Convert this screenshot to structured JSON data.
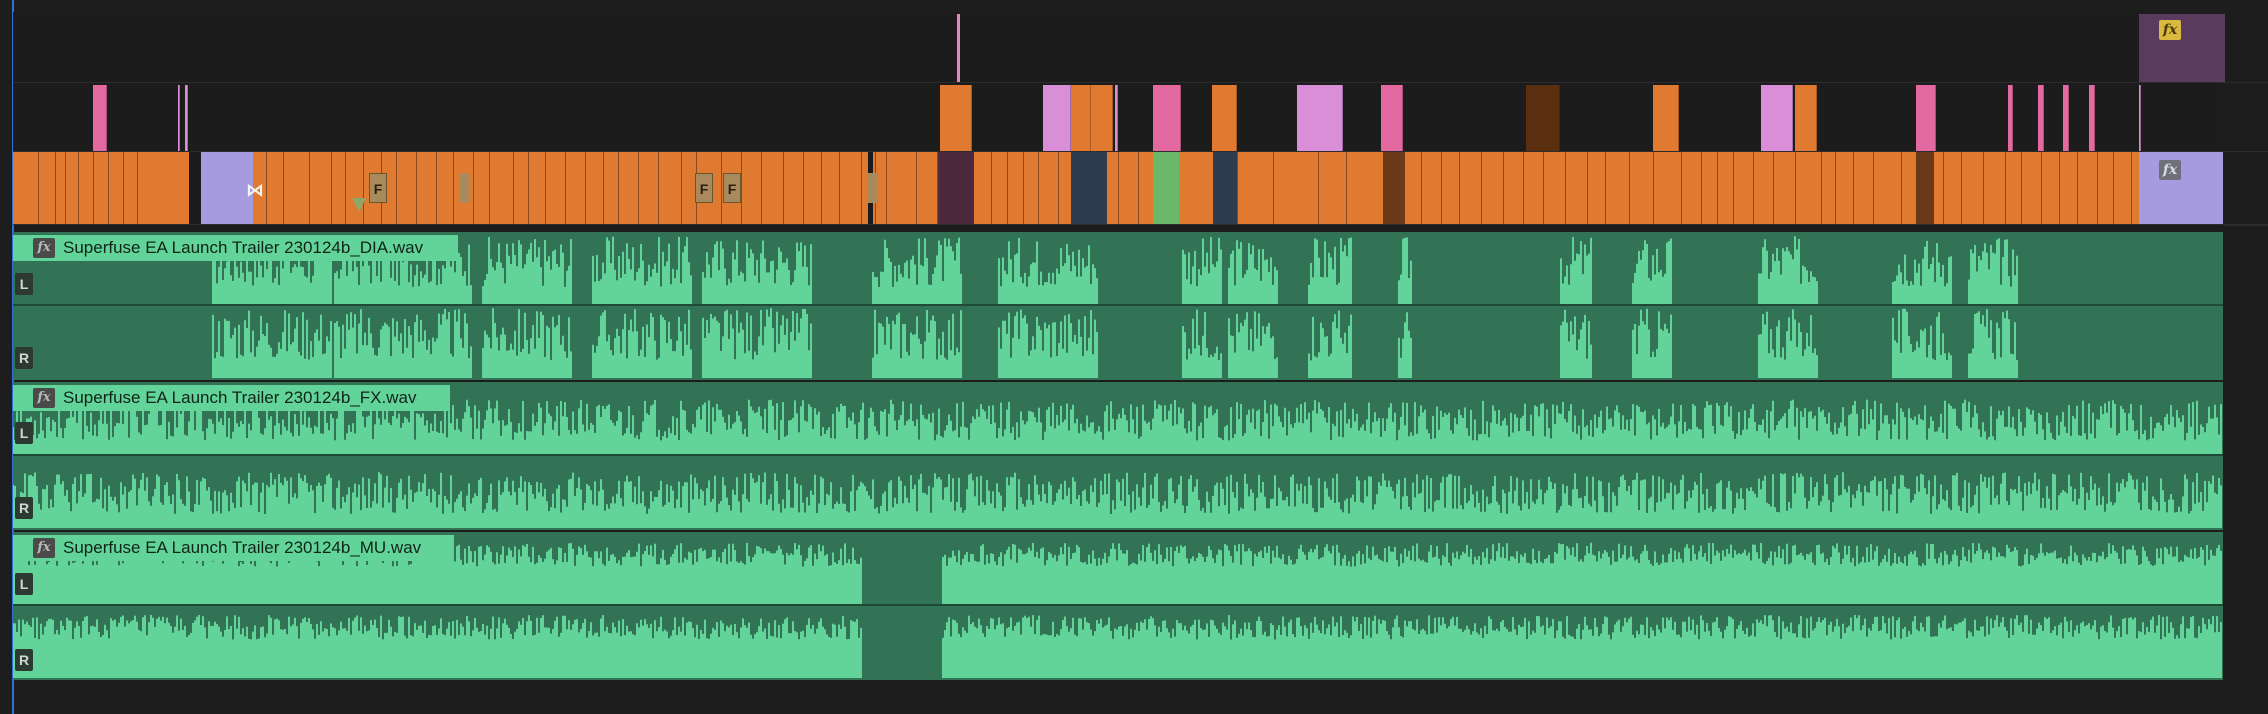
{
  "timeline": {
    "video_fx_badge": "fx",
    "video_fx_badge_secondary": "fx",
    "frame_markers": [
      "F",
      "F",
      "F"
    ],
    "audio_clips": [
      {
        "name": "Superfuse EA Launch Trailer 230124b_DIA.wav",
        "fx_label": "fx",
        "left_channel": "L",
        "right_channel": "R"
      },
      {
        "name": "Superfuse EA Launch Trailer 230124b_FX.wav",
        "fx_label": "fx",
        "left_channel": "L",
        "right_channel": "R"
      },
      {
        "name": "Superfuse EA Launch Trailer 230124b_MU.wav",
        "fx_label": "fx",
        "left_channel": "L",
        "right_channel": "R"
      }
    ]
  },
  "colors": {
    "background": "#1d1d1d",
    "video_clip": "#e07a30",
    "video_clip_dark": "#2e3a4e",
    "adjustment_pink": "#e26aa0",
    "adjustment_lilac": "#d98ed8",
    "adjustment_purple": "#a79be0",
    "graphic_green": "#6ab86a",
    "audio_clip": "#317354",
    "audio_waveform": "#62d49a",
    "playhead": "#2f6fd6"
  }
}
